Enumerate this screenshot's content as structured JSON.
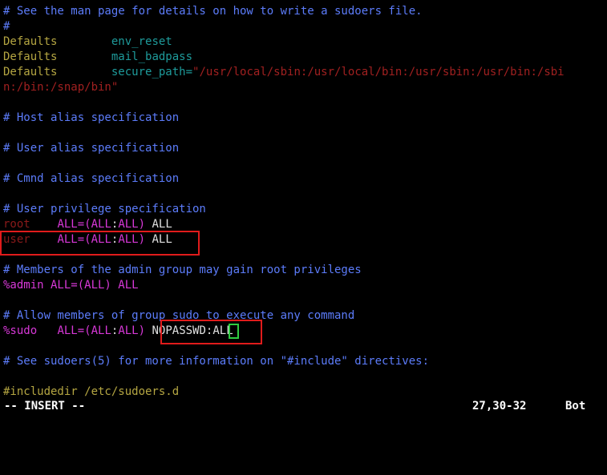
{
  "terminal": {
    "background_color": "#000000",
    "app": "vim",
    "file": "/etc/sudoers"
  },
  "colors": {
    "comment": "#5c7cfa",
    "keyword": "#b5a642",
    "parameter": "#1e9b9b",
    "string": "#a02020",
    "username": "#8b1a1a",
    "spec": "#d838d8",
    "plain": "#e0e0e0",
    "annotation_box": "#e01b1b",
    "cursor": "#2ecc40"
  },
  "buffer": {
    "lines": [
      {
        "id": "line-1",
        "text": "# See the man page for details on how to write a sudoers file."
      },
      {
        "id": "line-2",
        "text": "#"
      },
      {
        "id": "line-3",
        "keyword": "Defaults",
        "gap": "        ",
        "param": "env_reset"
      },
      {
        "id": "line-4",
        "keyword": "Defaults",
        "gap": "        ",
        "param": "mail_badpass"
      },
      {
        "id": "line-5",
        "keyword": "Defaults",
        "gap": "        ",
        "param": "secure_path=",
        "string": "\"/usr/local/sbin:/usr/local/bin:/usr/sbin:/usr/bin:/sbi"
      },
      {
        "id": "line-5b",
        "string": "n:/bin:/snap/bin\""
      },
      {
        "id": "line-6",
        "text": ""
      },
      {
        "id": "line-7",
        "text": "# Host alias specification"
      },
      {
        "id": "line-8",
        "text": ""
      },
      {
        "id": "line-9",
        "text": "# User alias specification"
      },
      {
        "id": "line-10",
        "text": ""
      },
      {
        "id": "line-11",
        "text": "# Cmnd alias specification"
      },
      {
        "id": "line-12",
        "text": ""
      },
      {
        "id": "line-13",
        "text": "# User privilege specification"
      },
      {
        "id": "line-14",
        "user": "root",
        "gap": "    ",
        "spec1": "ALL=(ALL",
        "colon": ":",
        "spec2": "ALL)",
        "sp": " ",
        "cmd": "ALL"
      },
      {
        "id": "line-15",
        "user": "user",
        "gap": "    ",
        "spec1": "ALL=(ALL",
        "colon": ":",
        "spec2": "ALL)",
        "sp": " ",
        "cmd": "ALL"
      },
      {
        "id": "line-16",
        "text": ""
      },
      {
        "id": "line-17",
        "text": "# Members of the admin group may gain root privileges"
      },
      {
        "id": "line-18",
        "spec_all": "%admin ALL=(ALL) ALL"
      },
      {
        "id": "line-19",
        "text": ""
      },
      {
        "id": "line-20",
        "text": "# Allow members of group sudo to execute any command"
      },
      {
        "id": "line-21",
        "user": "%sudo",
        "gap": "   ",
        "spec1": "ALL=(ALL",
        "colon": ":",
        "spec2": "ALL)",
        "sp": " ",
        "cmd": "NOPASSWD:ALL"
      },
      {
        "id": "line-22",
        "text": ""
      },
      {
        "id": "line-23",
        "text": "# See sudoers(5) for more information on \"#include\" directives:"
      },
      {
        "id": "line-24",
        "text": ""
      },
      {
        "id": "line-25",
        "yellow": "#includedir /etc/sudoers.d"
      }
    ],
    "line_text": {
      "l1": "# See the man page for details on how to write a sudoers file.",
      "l2": "#",
      "l3_key": "Defaults",
      "l3_gap": "        ",
      "l3_param": "env_reset",
      "l4_key": "Defaults",
      "l4_gap": "        ",
      "l4_param": "mail_badpass",
      "l5_key": "Defaults",
      "l5_gap": "        ",
      "l5_param": "secure_path=",
      "l5_string": "\"/usr/local/sbin:/usr/local/bin:/usr/sbin:/usr/bin:/sbi",
      "l5b_string": "n:/bin:/snap/bin\"",
      "l7": "# Host alias specification",
      "l9": "# User alias specification",
      "l11": "# Cmnd alias specification",
      "l13": "# User privilege specification",
      "l14_user": "root",
      "l14_gap": "    ",
      "l14_spec1": "ALL=(ALL",
      "l14_colon": ":",
      "l14_spec2": "ALL)",
      "l14_sp": " ",
      "l14_cmd": "ALL",
      "l15_user": "user",
      "l15_gap": "    ",
      "l15_spec1": "ALL=(ALL",
      "l15_colon": ":",
      "l15_spec2": "ALL)",
      "l15_sp": " ",
      "l15_cmd": "ALL",
      "l17": "# Members of the admin group may gain root privileges",
      "l18": "%admin ALL=(ALL) ALL",
      "l20": "# Allow members of group sudo to execute any command",
      "l21_user": "%sudo",
      "l21_gap": "   ",
      "l21_spec1": "ALL=(ALL",
      "l21_colon": ":",
      "l21_spec2": "ALL)",
      "l21_sp": " ",
      "l21_cmd": "NOPASSWD:",
      "l21_cmd_cursor": "A",
      "l21_cmd_rest": "LL",
      "l23": "# See sudoers(5) for more information on \"#include\" directives:",
      "l25": "#includedir /etc/sudoers.d"
    }
  },
  "statusline": {
    "mode": "-- INSERT --",
    "position": "27,30-32",
    "scroll": "Bot"
  },
  "annotations": {
    "user_line_box": "highlight-user-rule",
    "nopasswd_box": "highlight-nopasswd-directive"
  }
}
